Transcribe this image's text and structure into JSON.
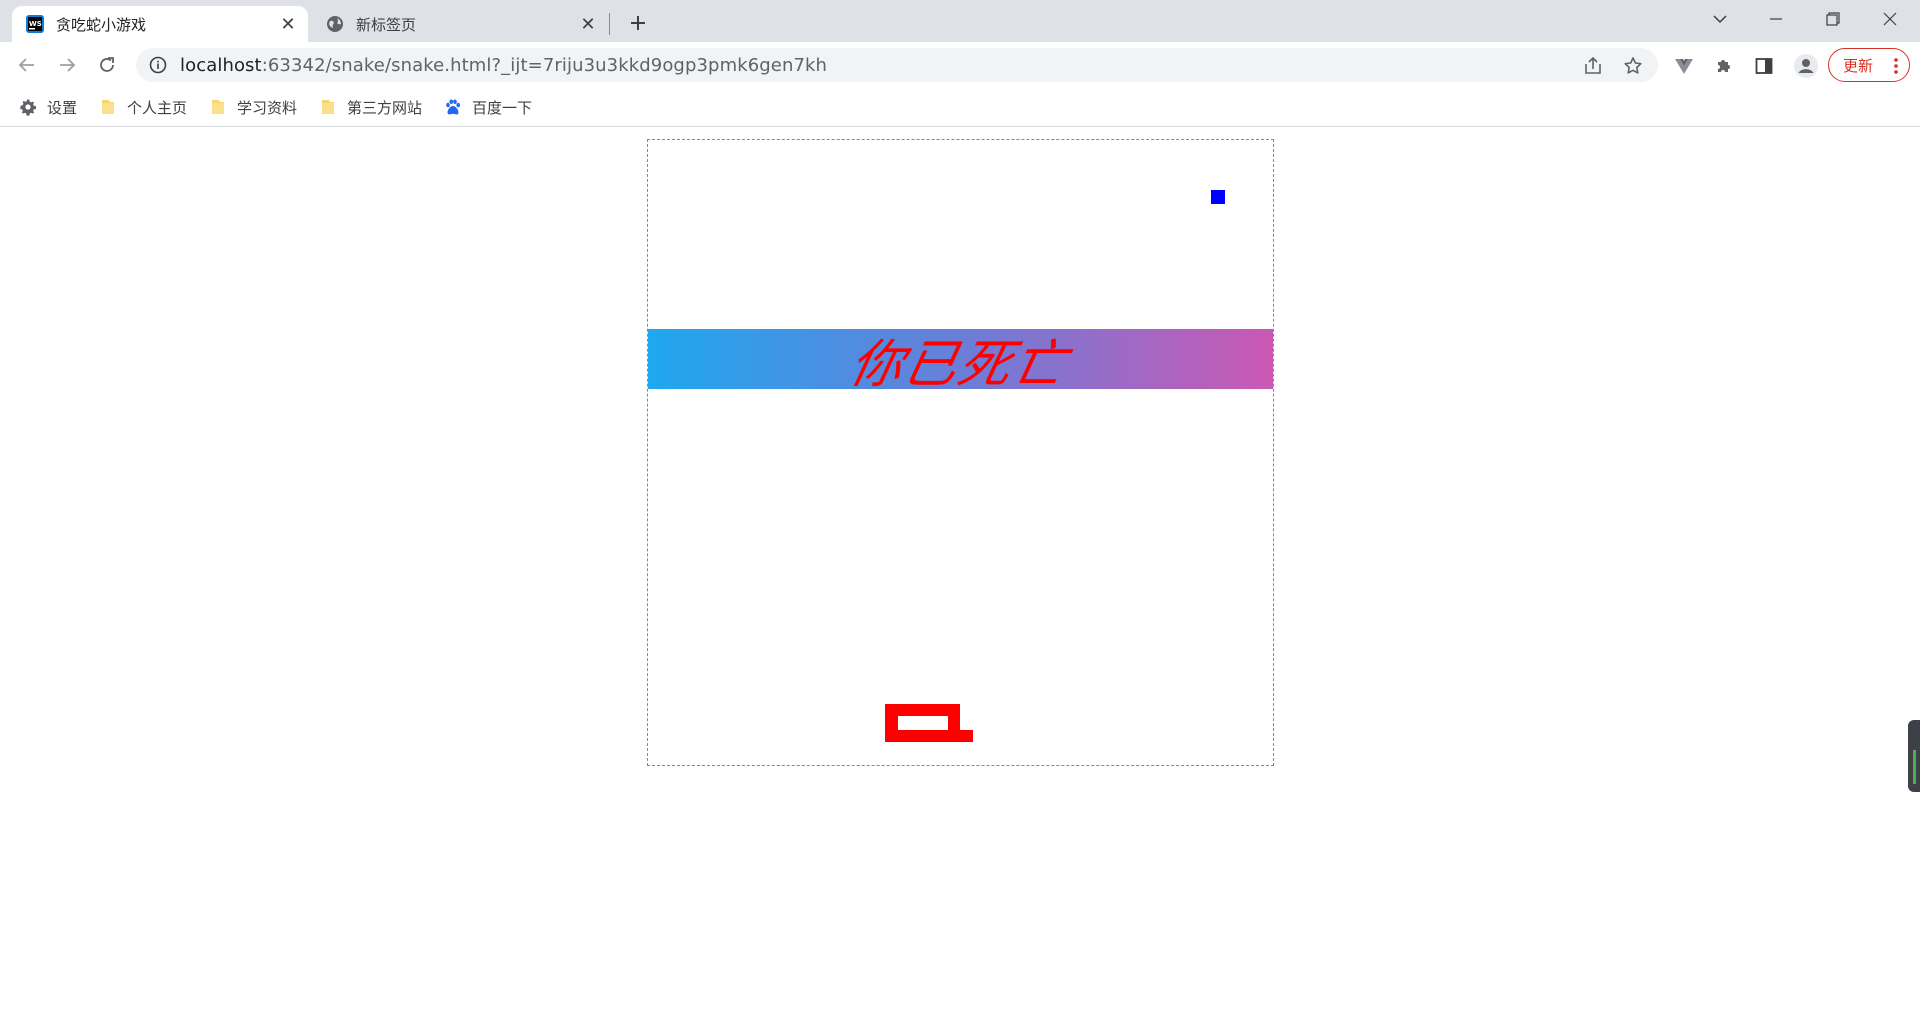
{
  "tabs": [
    {
      "title": "贪吃蛇小游戏",
      "active": true,
      "icon": "webstorm-icon"
    },
    {
      "title": "新标签页",
      "active": false,
      "icon": "globe-icon"
    }
  ],
  "address_bar": {
    "host": "localhost",
    "rest": ":63342/snake/snake.html?_ijt=7riju3u3kkd9ogp3pmk6gen7kh"
  },
  "update_button": {
    "label": "更新"
  },
  "bookmarks": [
    {
      "label": "设置",
      "icon": "gear-icon"
    },
    {
      "label": "个人主页",
      "icon": "folder-icon"
    },
    {
      "label": "学习资料",
      "icon": "folder-icon"
    },
    {
      "label": "第三方网站",
      "icon": "folder-icon"
    },
    {
      "label": "百度一下",
      "icon": "baidu-paw-icon"
    }
  ],
  "game": {
    "game_over_text": "你已死亡",
    "food_color": "#0000ff",
    "snake_color": "#ff0000",
    "banner_gradient": [
      "#1ea8ef",
      "#cb58b4"
    ]
  }
}
